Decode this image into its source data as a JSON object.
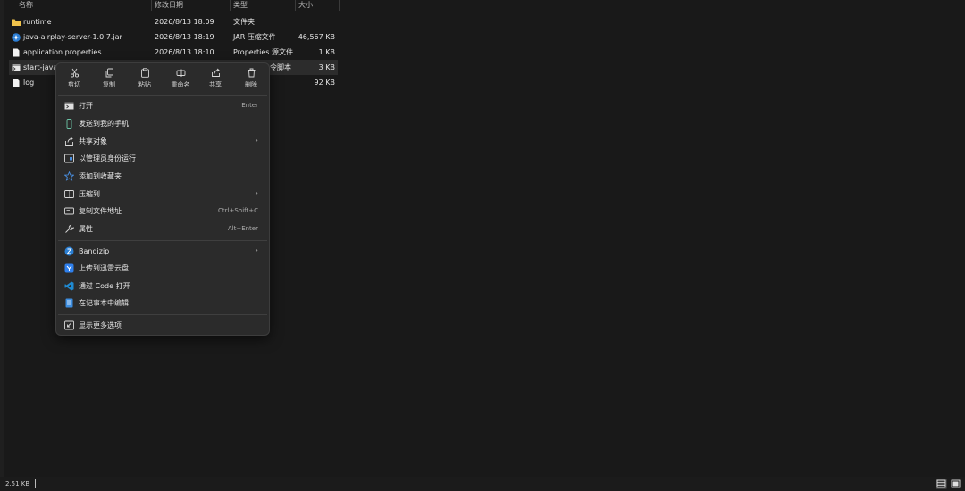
{
  "columns": {
    "name": "名称",
    "modified": "修改日期",
    "type": "类型",
    "size": "大小"
  },
  "files": [
    {
      "name": "runtime",
      "modified": "2026/8/13 18:09",
      "type": "文件夹",
      "size": "",
      "icon": "folder-icon"
    },
    {
      "name": "java-airplay-server-1.0.7.jar",
      "modified": "2026/8/13 18:19",
      "type": "JAR 压缩文件",
      "size": "46,567 KB",
      "icon": "jar-file-icon"
    },
    {
      "name": "application.properties",
      "modified": "2026/8/13 18:10",
      "type": "Properties 源文件",
      "size": "1 KB",
      "icon": "document-icon"
    },
    {
      "name": "start-java-",
      "modified": "",
      "type": "令脚本",
      "size": "3 KB",
      "icon": "script-file-icon"
    },
    {
      "name": "log",
      "modified": "",
      "type": "",
      "size": "92 KB",
      "icon": "document-icon"
    }
  ],
  "context_menu": {
    "quick_actions": [
      {
        "label": "剪切",
        "icon": "cut-icon"
      },
      {
        "label": "复制",
        "icon": "copy-icon"
      },
      {
        "label": "粘贴",
        "icon": "paste-icon"
      },
      {
        "label": "重命名",
        "icon": "rename-icon"
      },
      {
        "label": "共享",
        "icon": "share-icon"
      },
      {
        "label": "删除",
        "icon": "delete-icon"
      }
    ],
    "items": [
      {
        "label": "打开",
        "shortcut": "Enter",
        "icon": "open-icon"
      },
      {
        "label": "发送到我的手机",
        "shortcut": "",
        "icon": "phone-icon"
      },
      {
        "label": "共享对象",
        "shortcut": "",
        "submenu": true,
        "icon": "share-object-icon"
      },
      {
        "label": "以管理员身份运行",
        "shortcut": "",
        "icon": "admin-shield-icon"
      },
      {
        "label": "添加到收藏夹",
        "shortcut": "",
        "icon": "star-icon"
      },
      {
        "label": "压缩到...",
        "shortcut": "",
        "submenu": true,
        "icon": "compress-icon"
      },
      {
        "label": "复制文件地址",
        "shortcut": "Ctrl+Shift+C",
        "icon": "copy-path-icon"
      },
      {
        "label": "属性",
        "shortcut": "Alt+Enter",
        "icon": "wrench-icon"
      },
      {
        "label": "Bandizip",
        "shortcut": "",
        "submenu": true,
        "icon": "bandizip-icon"
      },
      {
        "label": "上传到迅雷云盘",
        "shortcut": "",
        "icon": "xunlei-icon"
      },
      {
        "label": "通过 Code 打开",
        "shortcut": "",
        "icon": "vscode-icon"
      },
      {
        "label": "在记事本中编辑",
        "shortcut": "",
        "icon": "notepad-icon"
      },
      {
        "label": "显示更多选项",
        "shortcut": "",
        "icon": "more-options-icon"
      }
    ],
    "submenu_arrow": "›"
  },
  "status_bar": {
    "selection_size": "2.51 KB"
  },
  "colors": {
    "background": "#191919",
    "menu_bg": "#2b2b2b",
    "folder": "#f0c24b",
    "accent_blue": "#3b8be0"
  }
}
